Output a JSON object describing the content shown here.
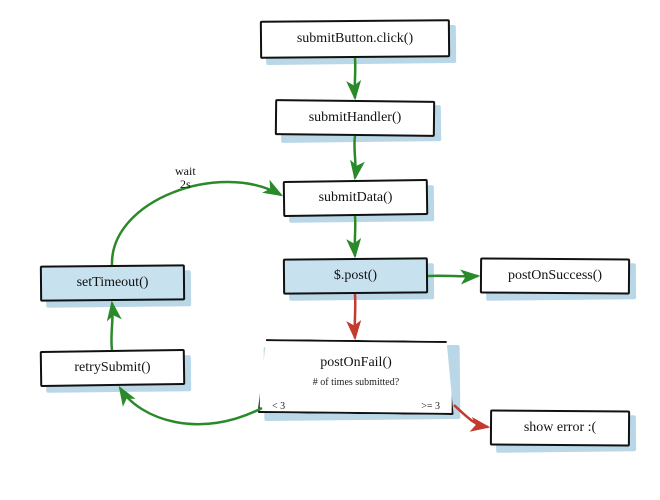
{
  "nodes": {
    "submitButton": {
      "label": "submitButton.click()"
    },
    "submitHandler": {
      "label": "submitHandler()"
    },
    "submitData": {
      "label": "submitData()"
    },
    "post": {
      "label": "$.post()"
    },
    "postOnSuccess": {
      "label": "postOnSuccess()"
    },
    "postOnFail": {
      "label": "postOnFail()",
      "subtext": "# of times submitted?",
      "left_branch": "< 3",
      "right_branch": ">= 3"
    },
    "retrySubmit": {
      "label": "retrySubmit()"
    },
    "setTimeout": {
      "label": "setTimeout()"
    },
    "showError": {
      "label": "show error :("
    }
  },
  "edge_labels": {
    "wait2s": "wait\n2s"
  },
  "colors": {
    "green": "#2a8a2a",
    "red": "#c33a2f",
    "blue_fill": "#c7e1ef",
    "shadow": "#b9d7e6",
    "stroke": "#111111"
  },
  "chart_data": {
    "type": "flowchart",
    "nodes": [
      {
        "id": "submitButton",
        "label": "submitButton.click()",
        "highlight": false
      },
      {
        "id": "submitHandler",
        "label": "submitHandler()",
        "highlight": false
      },
      {
        "id": "submitData",
        "label": "submitData()",
        "highlight": false
      },
      {
        "id": "post",
        "label": "$.post()",
        "highlight": true
      },
      {
        "id": "postOnSuccess",
        "label": "postOnSuccess()",
        "highlight": false
      },
      {
        "id": "postOnFail",
        "label": "postOnFail()",
        "highlight": false,
        "subtext": "# of times submitted?",
        "branches": {
          "left": "< 3",
          "right": ">= 3"
        }
      },
      {
        "id": "retrySubmit",
        "label": "retrySubmit()",
        "highlight": false
      },
      {
        "id": "setTimeout",
        "label": "setTimeout()",
        "highlight": true
      },
      {
        "id": "showError",
        "label": "show error :(",
        "highlight": false
      }
    ],
    "edges": [
      {
        "from": "submitButton",
        "to": "submitHandler",
        "color": "green"
      },
      {
        "from": "submitHandler",
        "to": "submitData",
        "color": "green"
      },
      {
        "from": "submitData",
        "to": "post",
        "color": "green"
      },
      {
        "from": "post",
        "to": "postOnSuccess",
        "color": "green"
      },
      {
        "from": "post",
        "to": "postOnFail",
        "color": "red"
      },
      {
        "from": "postOnFail",
        "to": "showError",
        "color": "red",
        "condition": ">= 3"
      },
      {
        "from": "postOnFail",
        "to": "retrySubmit",
        "color": "green",
        "condition": "< 3"
      },
      {
        "from": "retrySubmit",
        "to": "setTimeout",
        "color": "green"
      },
      {
        "from": "setTimeout",
        "to": "submitData",
        "color": "green",
        "label": "wait 2s"
      }
    ]
  }
}
